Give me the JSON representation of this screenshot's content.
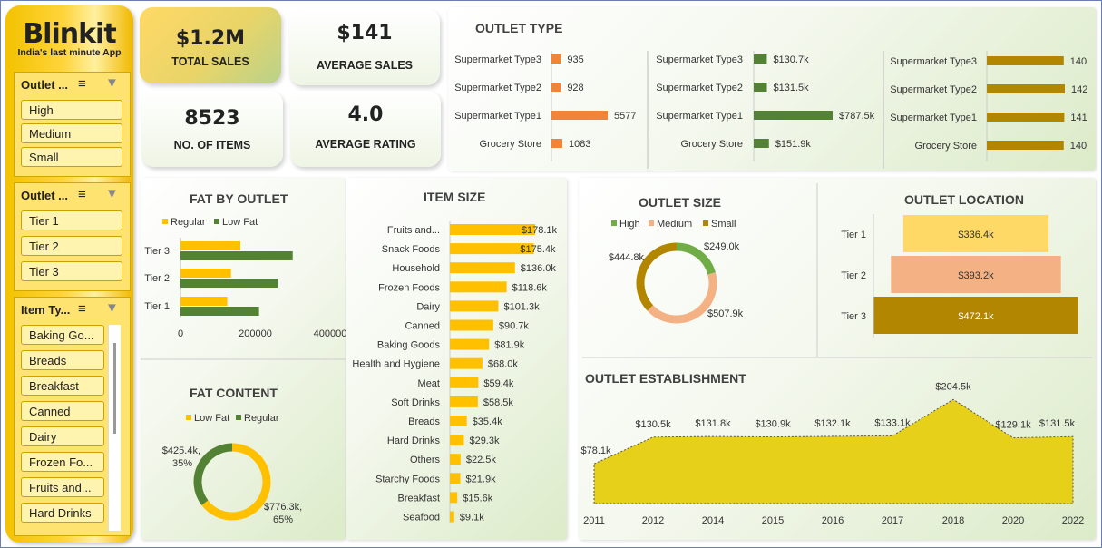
{
  "brand": {
    "name": "Blinkit",
    "tagline": "India's last minute App"
  },
  "slicers": [
    {
      "header": "Outlet ...",
      "items": [
        "High",
        "Medium",
        "Small"
      ]
    },
    {
      "header": "Outlet ...",
      "items": [
        "Tier 1",
        "Tier 2",
        "Tier 3"
      ]
    },
    {
      "header": "Item Ty...",
      "items": [
        "Baking Go...",
        "Breads",
        "Breakfast",
        "Canned",
        "Dairy",
        "Frozen Fo...",
        "Fruits and...",
        "Hard Drinks"
      ]
    }
  ],
  "kpis": {
    "total_sales": {
      "value": "$1.2M",
      "label": "TOTAL SALES"
    },
    "average_sales": {
      "value": "$141",
      "label": "AVERAGE SALES"
    },
    "items": {
      "value": "8523",
      "label": "NO. OF ITEMS"
    },
    "average_rating": {
      "value": "4.0",
      "label": "AVERAGE RATING"
    }
  },
  "colors": {
    "orange": "#f0843a",
    "green": "#548235",
    "olive": "#b38600",
    "yellow": "#ffc000",
    "area": "#e6d01a",
    "light_orange": "#f4b183",
    "light_yellow": "#ffd966",
    "light_green": "#70ad47"
  },
  "chart_data": [
    {
      "id": "outlet_type_items",
      "title": "OUTLET TYPE",
      "type": "bar",
      "categories": [
        "Supermarket Type3",
        "Supermarket Type2",
        "Supermarket Type1",
        "Grocery Store"
      ],
      "values": [
        935,
        928,
        5577,
        1083
      ],
      "labels": [
        "935",
        "928",
        "5577",
        "1083"
      ]
    },
    {
      "id": "outlet_type_sales",
      "type": "bar",
      "categories": [
        "Supermarket Type3",
        "Supermarket Type2",
        "Supermarket Type1",
        "Grocery Store"
      ],
      "values": [
        130.7,
        131.5,
        787.5,
        151.9
      ],
      "labels": [
        "$130.7k",
        "$131.5k",
        "$787.5k",
        "$151.9k"
      ]
    },
    {
      "id": "outlet_type_avg",
      "type": "bar",
      "categories": [
        "Supermarket Type3",
        "Supermarket Type2",
        "Supermarket Type1",
        "Grocery Store"
      ],
      "values": [
        140,
        142,
        141,
        140
      ],
      "labels": [
        "140",
        "142",
        "141",
        "140"
      ]
    },
    {
      "id": "fat_by_outlet",
      "title": "FAT BY OUTLET",
      "type": "bar",
      "categories": [
        "Tier 3",
        "Tier 2",
        "Tier 1"
      ],
      "series": [
        {
          "name": "Regular",
          "values": [
            160000,
            135000,
            125000
          ]
        },
        {
          "name": "Low Fat",
          "values": [
            300000,
            260000,
            210000
          ]
        }
      ],
      "ticks": [
        "0",
        "200000",
        "400000"
      ],
      "xlim": [
        0,
        400000
      ]
    },
    {
      "id": "fat_content",
      "title": "FAT CONTENT",
      "type": "pie",
      "categories": [
        "Low Fat",
        "Regular"
      ],
      "values": [
        776.3,
        425.4
      ],
      "labels": [
        "$776.3k,\n65%",
        "$425.4k,\n35%"
      ]
    },
    {
      "id": "item_size",
      "title": "ITEM SIZE",
      "type": "bar",
      "categories": [
        "Fruits and...",
        "Snack Foods",
        "Household",
        "Frozen Foods",
        "Dairy",
        "Canned",
        "Baking Goods",
        "Health and Hygiene",
        "Meat",
        "Soft Drinks",
        "Breads",
        "Hard Drinks",
        "Others",
        "Starchy Foods",
        "Breakfast",
        "Seafood"
      ],
      "values": [
        178.1,
        175.4,
        136.0,
        118.6,
        101.3,
        90.7,
        81.9,
        68.0,
        59.4,
        58.5,
        35.4,
        29.3,
        22.5,
        21.9,
        15.6,
        9.1
      ],
      "labels": [
        "$178.1k",
        "$175.4k",
        "$136.0k",
        "$118.6k",
        "$101.3k",
        "$90.7k",
        "$81.9k",
        "$68.0k",
        "$59.4k",
        "$58.5k",
        "$35.4k",
        "$29.3k",
        "$22.5k",
        "$21.9k",
        "$15.6k",
        "$9.1k"
      ]
    },
    {
      "id": "outlet_size",
      "title": "OUTLET SIZE",
      "type": "pie",
      "categories": [
        "High",
        "Medium",
        "Small"
      ],
      "values": [
        249.0,
        507.9,
        444.8
      ],
      "labels": [
        "$249.0k",
        "$507.9k",
        "$444.8k"
      ]
    },
    {
      "id": "outlet_location",
      "title": "OUTLET LOCATION",
      "type": "bar",
      "categories": [
        "Tier 1",
        "Tier 2",
        "Tier 3"
      ],
      "values": [
        336.4,
        393.2,
        472.1
      ],
      "labels": [
        "$336.4k",
        "$393.2k",
        "$472.1k"
      ]
    },
    {
      "id": "outlet_establishment",
      "title": "OUTLET ESTABLISHMENT",
      "type": "area",
      "x": [
        "2011",
        "2012",
        "2014",
        "2015",
        "2016",
        "2017",
        "2018",
        "2020",
        "2022"
      ],
      "values": [
        78.1,
        130.5,
        131.8,
        130.9,
        132.1,
        133.1,
        204.5,
        129.1,
        131.5
      ],
      "labels": [
        "$78.1k",
        "$130.5k",
        "$131.8k",
        "$130.9k",
        "$132.1k",
        "$133.1k",
        "$204.5k",
        "$129.1k",
        "$131.5k"
      ]
    }
  ]
}
